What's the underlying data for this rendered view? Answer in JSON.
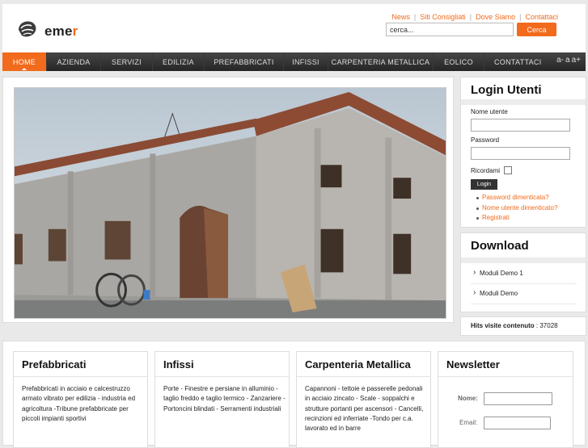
{
  "header": {
    "logo_text_main": "eme",
    "logo_text_accent": "r",
    "top_links": [
      "News",
      "Siti Consigliati",
      "Dove Siamo",
      "Contattaci"
    ],
    "search_placeholder": "cerca...",
    "search_button": "Cerca"
  },
  "nav": {
    "items": [
      "HOME",
      "AZIENDA",
      "SERVIZI",
      "EDILIZIA",
      "PREFABBRICATI",
      "INFISSI",
      "CARPENTERIA METALLICA",
      "EOLICO",
      "CONTATTACI"
    ],
    "active_index": 0,
    "font_tools": [
      "a-",
      "a",
      "a+"
    ]
  },
  "login": {
    "title": "Login Utenti",
    "username_label": "Nome utente",
    "password_label": "Password",
    "remember_label": "Ricordami",
    "button": "Login",
    "links": [
      "Password dimenticata?",
      "Nome utente dimenticato?",
      "Registrati"
    ]
  },
  "download": {
    "title": "Download",
    "items": [
      "Moduli Demo 1",
      "Moduli Demo"
    ]
  },
  "hits": {
    "label": "Hits visite contenuto",
    "value": "37028"
  },
  "boxes": [
    {
      "title": "Prefabbricati",
      "text": "Prefabbricati in acciaio e calcestruzzo armato vibrato per edilizia - industria ed agricoltura -Tribune prefabbricate per piccoli impianti sportivi"
    },
    {
      "title": "Infissi",
      "text": "Porte - Finestre e persiane in alluminio - taglio freddo e taglio termico - Zanzariere - Portoncini blindati - Serramenti industriali"
    },
    {
      "title": "Carpenteria Metallica",
      "text": "Capannoni - tettoie e passerelle pedonali in acciaio zincato - Scale - soppalchi e strutture portanti per ascensori - Cancelli, recinzioni ed inferriate -Tondo per c.a. lavorato ed in barre"
    }
  ],
  "newsletter": {
    "title": "Newsletter",
    "name_label": "Nome:",
    "email_label": "Email:"
  },
  "colors": {
    "accent": "#f26a1b",
    "nav_dark": "#2f2f2f"
  }
}
